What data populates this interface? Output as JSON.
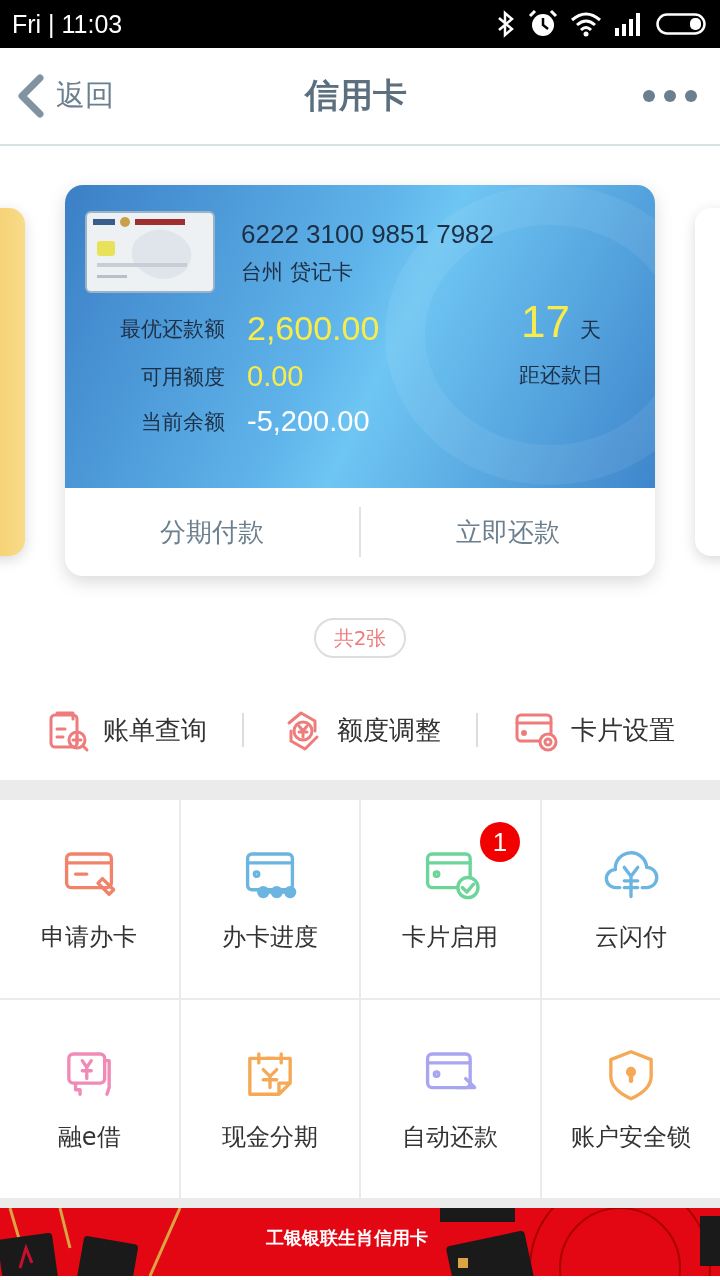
{
  "status_bar": {
    "time": "Fri | 11:03"
  },
  "nav": {
    "back": "返回",
    "title": "信用卡"
  },
  "card": {
    "number": "6222 3100 9851 7982",
    "type": "台州 贷记卡",
    "rows": [
      {
        "label": "最优还款额",
        "value": "2,600.00",
        "emphasis": true
      },
      {
        "label": "可用额度",
        "value": "0.00",
        "emphasis": true
      },
      {
        "label": "当前余额",
        "value": "-5,200.00",
        "emphasis": false
      }
    ],
    "days": "17",
    "days_unit": "天",
    "due_label": "距还款日",
    "actions": [
      "分期付款",
      "立即还款"
    ]
  },
  "card_count": "共2张",
  "quick_actions": [
    {
      "label": "账单查询"
    },
    {
      "label": "额度调整"
    },
    {
      "label": "卡片设置"
    }
  ],
  "services": [
    {
      "label": "申请办卡"
    },
    {
      "label": "办卡进度"
    },
    {
      "label": "卡片启用",
      "badge": "1"
    },
    {
      "label": "云闪付"
    },
    {
      "label": "融e借"
    },
    {
      "label": "现金分期"
    },
    {
      "label": "自动还款"
    },
    {
      "label": "账户安全锁"
    }
  ],
  "banner": {
    "title": "工银银联生肖信用卡"
  }
}
